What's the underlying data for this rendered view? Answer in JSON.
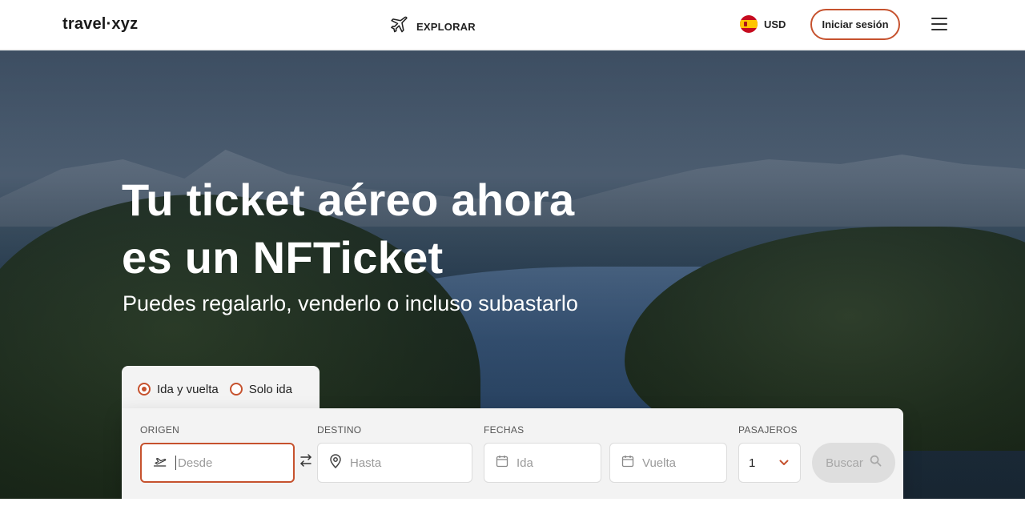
{
  "header": {
    "logo": "travel·xyz",
    "explore_label": "EXPLORAR",
    "currency": "USD",
    "login_label": "Iniciar sesión"
  },
  "hero": {
    "title_line1": "Tu ticket aéreo ahora",
    "title_line2": "es un NFTicket",
    "subtitle": "Puedes regalarlo, venderlo o incluso subastarlo"
  },
  "trip_type": {
    "options": [
      "Ida y vuelta",
      "Solo ida"
    ],
    "selected": "Ida y vuelta"
  },
  "search": {
    "origin_label": "ORIGEN",
    "origin_placeholder": "Desde",
    "destination_label": "DESTINO",
    "destination_placeholder": "Hasta",
    "dates_label": "FECHAS",
    "depart_placeholder": "Ida",
    "return_placeholder": "Vuelta",
    "passengers_label": "PASAJEROS",
    "passengers_value": "1",
    "search_label": "Buscar"
  },
  "colors": {
    "accent": "#c6522e",
    "card_bg": "#f3f3f3",
    "disabled_btn": "#dedede"
  },
  "icons": {
    "explore": "airplane-icon",
    "origin": "plane-takeoff-icon",
    "swap": "swap-arrows-icon",
    "destination": "map-pin-icon",
    "calendar": "calendar-icon",
    "dropdown": "chevron-down-icon",
    "search": "search-icon",
    "menu": "hamburger-menu-icon",
    "flag": "spain-flag-icon"
  }
}
